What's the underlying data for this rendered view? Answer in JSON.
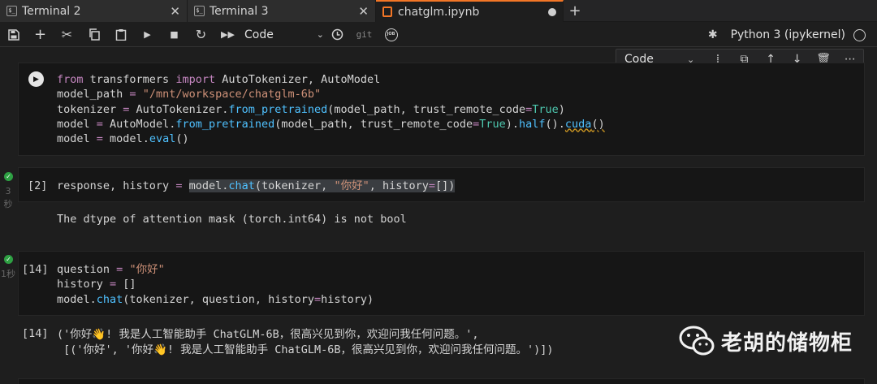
{
  "tabs": [
    {
      "label": "Terminal 2",
      "icon": "terminal-icon",
      "active": false
    },
    {
      "label": "Terminal 3",
      "icon": "terminal-icon",
      "active": false
    },
    {
      "label": "chatglm.ipynb",
      "icon": "notebook-icon",
      "active": true
    }
  ],
  "toolbar": {
    "cell_type": "Code",
    "git_label": "git",
    "job_label": "JOB",
    "kernel_name": "Python 3 (ipykernel)"
  },
  "cell_toolbar": {
    "cell_type": "Code"
  },
  "cells": [
    {
      "prompt": "",
      "lines": [
        "from transformers import AutoTokenizer, AutoModel",
        "model_path = \"/mnt/workspace/chatglm-6b\"",
        "tokenizer = AutoTokenizer.from_pretrained(model_path, trust_remote_code=True)",
        "model = AutoModel.from_pretrained(model_path, trust_remote_code=True).half().cuda()",
        "model = model.eval()"
      ]
    },
    {
      "prompt": "[2]",
      "exec_time": "3\n秒",
      "lines": [
        "response, history = model.chat(tokenizer, \"你好\", history=[])"
      ],
      "output": "The dtype of attention mask (torch.int64) is not bool"
    },
    {
      "prompt": "[14]",
      "exec_time": "1秒",
      "lines": [
        "question = \"你好\"",
        "history = []",
        "model.chat(tokenizer, question, history=history)"
      ],
      "output_prompt": "[14]",
      "output_lines": [
        "('你好👋! 我是人工智能助手 ChatGLM-6B，很高兴见到你，欢迎问我任何问题。',",
        " [('你好', '你好👋! 我是人工智能助手 ChatGLM-6B，很高兴见到你，欢迎问我任何问题。')])"
      ]
    }
  ],
  "watermark": {
    "text": "老胡的储物柜",
    "icon": "wechat-icon"
  }
}
